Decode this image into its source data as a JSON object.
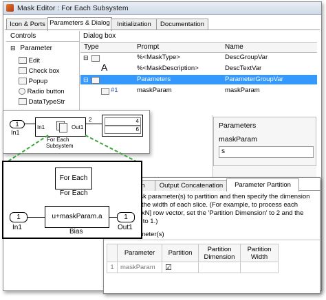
{
  "mask_editor": {
    "title": "Mask Editor : For Each Subsystem",
    "tabs": [
      "Icon & Ports",
      "Parameters & Dialog",
      "Initialization",
      "Documentation"
    ],
    "controls_header": "Controls",
    "parameter_group": "Parameter",
    "controls": [
      "Edit",
      "Check box",
      "Popup",
      "Radio button",
      "DataTypeStr"
    ],
    "dialog_header": "Dialog box",
    "columns": [
      "Type",
      "Prompt",
      "Name"
    ],
    "rows": [
      {
        "type": "",
        "prompt": "%<MaskType>",
        "name": "DescGroupVar"
      },
      {
        "type": "A",
        "prompt": "%<MaskDescription>",
        "name": "DescTextVar"
      },
      {
        "type": "",
        "prompt": "Parameters",
        "name": "ParameterGroupVar"
      },
      {
        "type": "#1",
        "prompt": "maskParam",
        "name": "maskParam"
      }
    ]
  },
  "top_model": {
    "in_port": "1",
    "in_label": "In1",
    "subsystem_in": "In1",
    "subsystem_out": "Out1",
    "subsystem_label": "For Each\nSubsystem",
    "subsystem_label_1": "For Each",
    "subsystem_label_2": "Subsystem",
    "sig_in": "2",
    "sig_out": "2",
    "display_values": [
      "4",
      "6"
    ]
  },
  "params_dialog": {
    "group_title": "Parameters",
    "param_label": "maskParam",
    "param_value": "s"
  },
  "sub_model": {
    "for_each_text": "For Each",
    "for_each_label": "For Each",
    "in_port": "1",
    "in_label": "In1",
    "bias_expr": "u+maskParam.a",
    "bias_label": "Bias",
    "out_port": "1",
    "out_label": "Out1"
  },
  "foreach_dialog": {
    "tabs": [
      "Input Partition",
      "Output Concatenation",
      "Parameter Partition"
    ],
    "tab_first_visible": "on",
    "description_lines": [
      "ask parameter(s) to partition and then specify the dimension",
      "d the width of each slice. (For example, to process each",
      "[1xN] row vector, set the 'Partition Dimension' to 2 and the",
      "h' to 1.)"
    ],
    "section": "ameter(s)",
    "columns": [
      "Parameter",
      "Partition",
      "Partition\nDimension",
      "Partition\nWidth"
    ],
    "col_partition_dim_1": "Partition",
    "col_partition_dim_2": "Dimension",
    "col_partition_w_1": "Partition",
    "col_partition_w_2": "Width",
    "row": {
      "index": "1",
      "parameter": "maskParam",
      "checked": "☑"
    }
  }
}
